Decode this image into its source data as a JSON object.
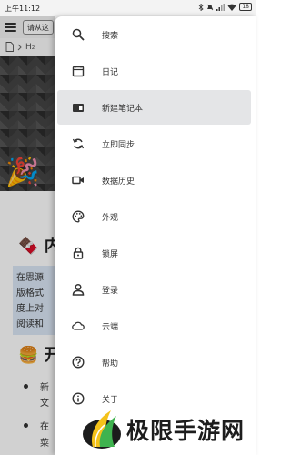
{
  "status_bar": {
    "time": "上午11:12",
    "battery": "18"
  },
  "toolbar": {
    "input_text": "请从这"
  },
  "breadcrumb": {
    "heading_tag": "H₂"
  },
  "document": {
    "heading_1": "内",
    "highlight_lines": [
      "在思源",
      "版格式",
      "度上对",
      "阅读和"
    ],
    "heading_2": "开",
    "bullet_items": [
      "新",
      "文",
      "在",
      "菜"
    ]
  },
  "drawer": {
    "items": [
      {
        "label": "搜索",
        "icon": "search-icon"
      },
      {
        "label": "日记",
        "icon": "calendar-icon"
      },
      {
        "label": "新建笔记本",
        "icon": "notebook-icon"
      },
      {
        "label": "立即同步",
        "icon": "sync-icon"
      },
      {
        "label": "数据历史",
        "icon": "video-icon"
      },
      {
        "label": "外观",
        "icon": "palette-icon"
      },
      {
        "label": "锁屏",
        "icon": "lock-icon"
      },
      {
        "label": "登录",
        "icon": "person-icon"
      },
      {
        "label": "云端",
        "icon": "cloud-icon"
      },
      {
        "label": "帮助",
        "icon": "help-icon"
      },
      {
        "label": "关于",
        "icon": "info-icon"
      }
    ],
    "active_item": "新建笔记本"
  },
  "watermark": {
    "text": "极限手游网"
  },
  "colors": {
    "drawer_bg": "#ffffff",
    "active_item_bg": "#e4e5e7",
    "highlight_bg": "#dbe7f6",
    "scrim": "rgba(0,0,0,0.18)"
  }
}
